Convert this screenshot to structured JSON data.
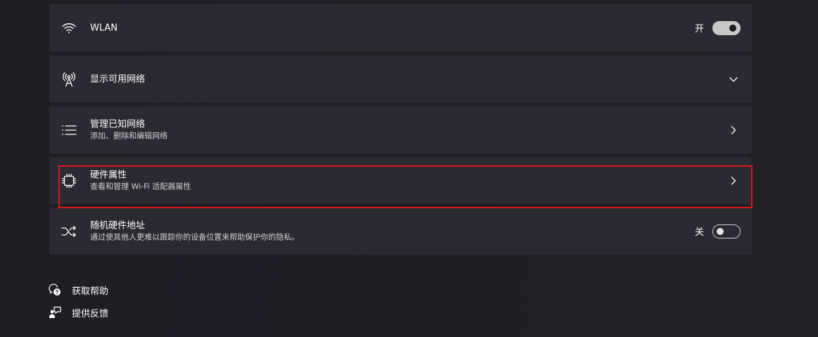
{
  "wlan": {
    "title": "WLAN",
    "toggle_label": "开",
    "toggle_state": "on",
    "icon": "wifi-icon"
  },
  "available_networks": {
    "title": "显示可用网络",
    "icon": "antenna-icon"
  },
  "known_networks": {
    "title": "管理已知网络",
    "subtitle": "添加、删除和编辑网络",
    "icon": "list-icon"
  },
  "hardware_properties": {
    "title": "硬件属性",
    "subtitle": "查看和管理 Wi-Fi 适配器属性",
    "icon": "chip-icon"
  },
  "random_hardware_address": {
    "title": "随机硬件地址",
    "subtitle": "通过使其他人更难以跟踪你的设备位置来帮助保护你的隐私。",
    "toggle_label": "关",
    "toggle_state": "off",
    "icon": "shuffle-icon"
  },
  "links": {
    "get_help": "获取帮助",
    "give_feedback": "提供反馈"
  },
  "colors": {
    "card_bg": "#2b2a32",
    "highlight_border": "#e0161e",
    "page_bg": "#1f1e25"
  }
}
